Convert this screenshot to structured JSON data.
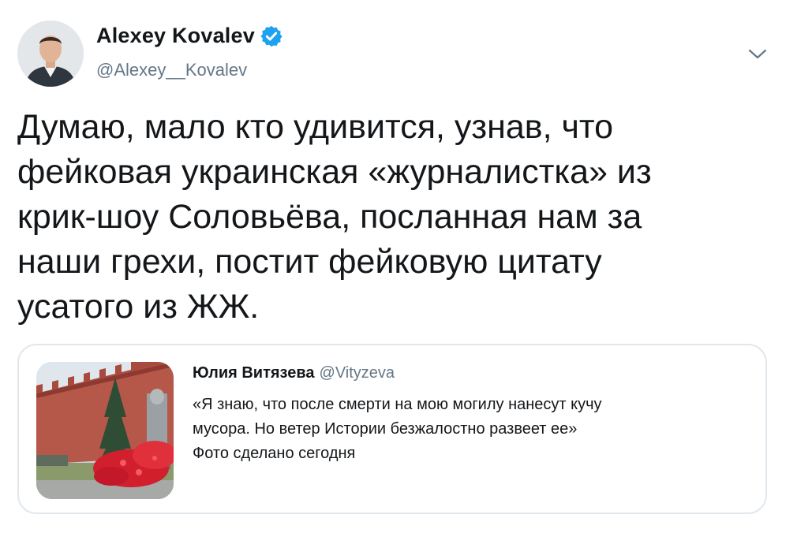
{
  "author": {
    "display_name": "Alexey Kovalev",
    "handle": "@Alexey__Kovalev",
    "verified": true,
    "avatar_icon": "profile-photo"
  },
  "menu": {
    "icon": "chevron-down-icon"
  },
  "tweet": {
    "lines": [
      "Думаю, мало кто удивится, узнав, что",
      "фейковая украинская «журналистка» из",
      "крик-шоу Соловьёва, посланная нам за",
      "наши грехи, постит фейковую цитату",
      "усатого из ЖЖ."
    ]
  },
  "quoted_tweet": {
    "display_name": "Юлия Витязева",
    "handle": "@Vityzeva",
    "lines": [
      "«Я знаю, что после смерти на мою могилу нанесут кучу",
      "мусора. Но ветер Истории безжалостно развеет ее»",
      "Фото сделано сегодня"
    ],
    "media_icon": "photo-thumbnail"
  },
  "colors": {
    "text": "#14171a",
    "secondary": "#657786",
    "verified": "#1da1f2",
    "border": "#e1e8ed"
  }
}
